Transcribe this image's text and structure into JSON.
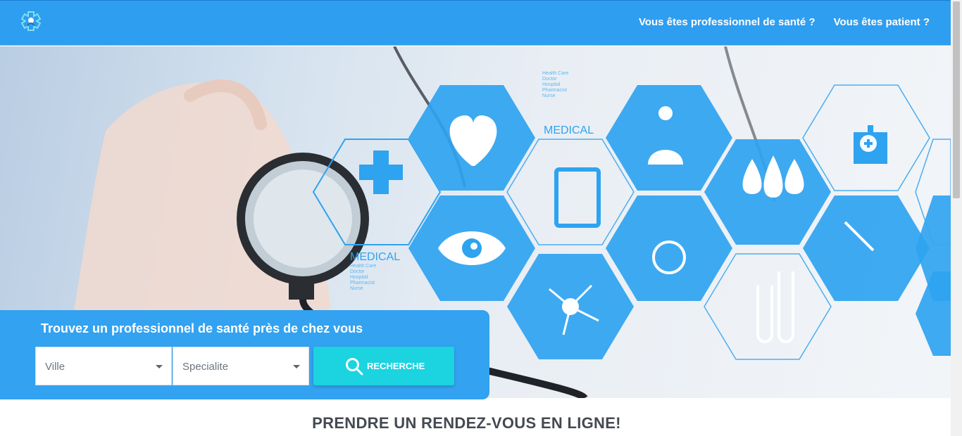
{
  "header": {
    "nav": [
      {
        "label": "Vous êtes professionnel de santé ?"
      },
      {
        "label": "Vous êtes patient ?"
      }
    ]
  },
  "hero": {
    "hex_words": [
      "MEDICAL",
      "MEDICAL"
    ],
    "hex_small_words": [
      "Health Care",
      "Doctor",
      "Hospital",
      "Pharmacist",
      "Nurse"
    ],
    "colors": {
      "hex_fill": "#2ea3f0",
      "hex_outline": "#3aa6ef"
    }
  },
  "search": {
    "title": "Trouvez un professionnel de santé près de chez vous",
    "city_placeholder": "Ville",
    "specialty_placeholder": "Specialite",
    "button_label": "RECHERCHE"
  },
  "main": {
    "section_title": "PRENDRE UN RENDEZ-VOUS EN LIGNE!"
  }
}
